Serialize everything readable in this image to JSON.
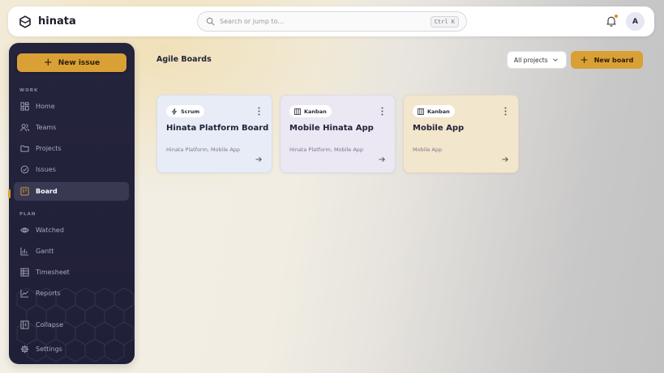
{
  "app": {
    "name": "hinata"
  },
  "search": {
    "placeholder": "Search or jump to...",
    "shortcut": "Ctrl K"
  },
  "user": {
    "avatar_initial": "A"
  },
  "sidebar": {
    "new_issue_label": "New issue",
    "sections": {
      "work": "WORK",
      "plan": "PLAN"
    },
    "work_items": [
      {
        "label": "Home",
        "icon": "grid-icon"
      },
      {
        "label": "Teams",
        "icon": "users-icon"
      },
      {
        "label": "Projects",
        "icon": "folder-icon"
      },
      {
        "label": "Issues",
        "icon": "check-circle-icon"
      },
      {
        "label": "Board",
        "icon": "board-icon",
        "active": true
      }
    ],
    "plan_items": [
      {
        "label": "Watched",
        "icon": "eye-icon"
      },
      {
        "label": "Gantt",
        "icon": "bar-chart-icon"
      },
      {
        "label": "Timesheet",
        "icon": "table-icon"
      },
      {
        "label": "Reports",
        "icon": "line-chart-icon"
      }
    ],
    "collapse_label": "Collapse",
    "settings_label": "Settings"
  },
  "main": {
    "title": "Agile Boards",
    "filter_label": "All projects",
    "new_board_label": "New board",
    "boards": [
      {
        "type": "Scrum",
        "title": "Hinata Platform Board",
        "projects": "Hinata Platform, Mobile App",
        "color": "#e8ecf6"
      },
      {
        "type": "Kanban",
        "title": "Mobile Hinata App",
        "projects": "Hinata Platform, Mobile App",
        "color": "#ebe7f3"
      },
      {
        "type": "Kanban",
        "title": "Mobile App",
        "projects": "Mobile App",
        "color": "#f2e6cc"
      }
    ]
  },
  "colors": {
    "accent": "#d9a035",
    "sidebar_bg": "#23223b"
  }
}
